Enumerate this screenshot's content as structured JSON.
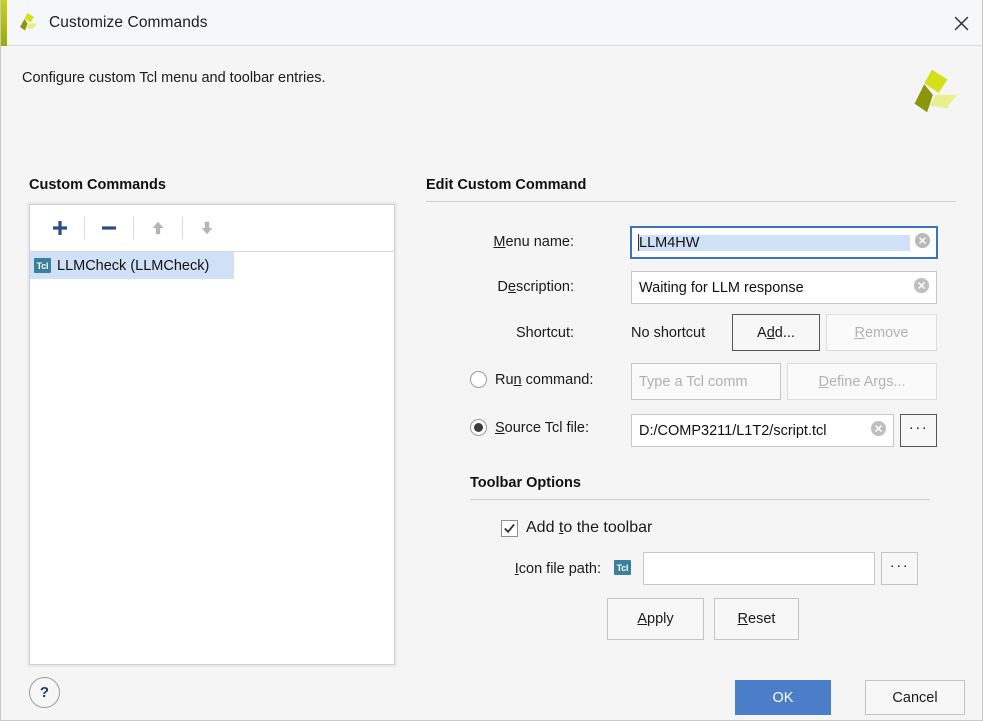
{
  "window": {
    "title": "Customize Commands",
    "close_label": "✕",
    "logo": "vivado-logo"
  },
  "intro": {
    "text": "Configure custom Tcl menu and toolbar entries."
  },
  "custom_commands": {
    "heading": "Custom Commands",
    "toolbar": {
      "add": "+",
      "remove": "−",
      "move_up": "↑",
      "move_down": "↓"
    },
    "items": [
      {
        "badge": "Tcl",
        "label": "LLMCheck (LLMCheck)",
        "selected": true
      }
    ]
  },
  "edit_command": {
    "heading": "Edit Custom Command",
    "menu_name": {
      "label_pre": "",
      "label_mnemonic": "M",
      "label_post": "enu name:",
      "value": "LLM4HW"
    },
    "description": {
      "label_pre": "D",
      "label_mnemonic": "e",
      "label_post": "scription:",
      "value": "Waiting for LLM response"
    },
    "shortcut": {
      "label": "Shortcut:",
      "status": "No shortcut",
      "add_pre": "A",
      "add_mnemonic": "d",
      "add_post": "d...",
      "remove_pre": "",
      "remove_mnemonic": "R",
      "remove_post": "emove",
      "remove_disabled": true
    },
    "run_command": {
      "label_pre": "Ru",
      "label_mnemonic": "n",
      "label_post": " command:",
      "selected": false,
      "placeholder": "Type a Tcl comm",
      "value": "",
      "define_args_pre": "",
      "define_args_mnemonic": "D",
      "define_args_post": "efine Args...",
      "define_args_disabled": true
    },
    "source_file": {
      "label_pre": "",
      "label_mnemonic": "S",
      "label_post": "ource Tcl file:",
      "selected": true,
      "value": "D:/COMP3211/L1T2/script.tcl",
      "browse_label": "···"
    }
  },
  "toolbar_options": {
    "heading": "Toolbar Options",
    "add_to_toolbar": {
      "label_pre": "Add ",
      "label_mnemonic": "t",
      "label_post": "o the toolbar",
      "checked": true
    },
    "icon_file_path": {
      "label_pre": "",
      "label_mnemonic": "I",
      "label_post": "con file path:",
      "badge": "Tcl",
      "value": "",
      "browse_label": "···"
    },
    "apply_pre": "",
    "apply_mnemonic": "A",
    "apply_post": "pply",
    "reset_pre": "",
    "reset_mnemonic": "R",
    "reset_post": "eset"
  },
  "footer": {
    "help": "?",
    "ok": "OK",
    "cancel": "Cancel"
  },
  "colors": {
    "accent_green": "#c8d419",
    "primary_blue": "#4a7ec8",
    "selection_blue": "#cfe0f7",
    "tcl_badge": "#3a7f9c",
    "focus_border": "#3a73c0"
  }
}
